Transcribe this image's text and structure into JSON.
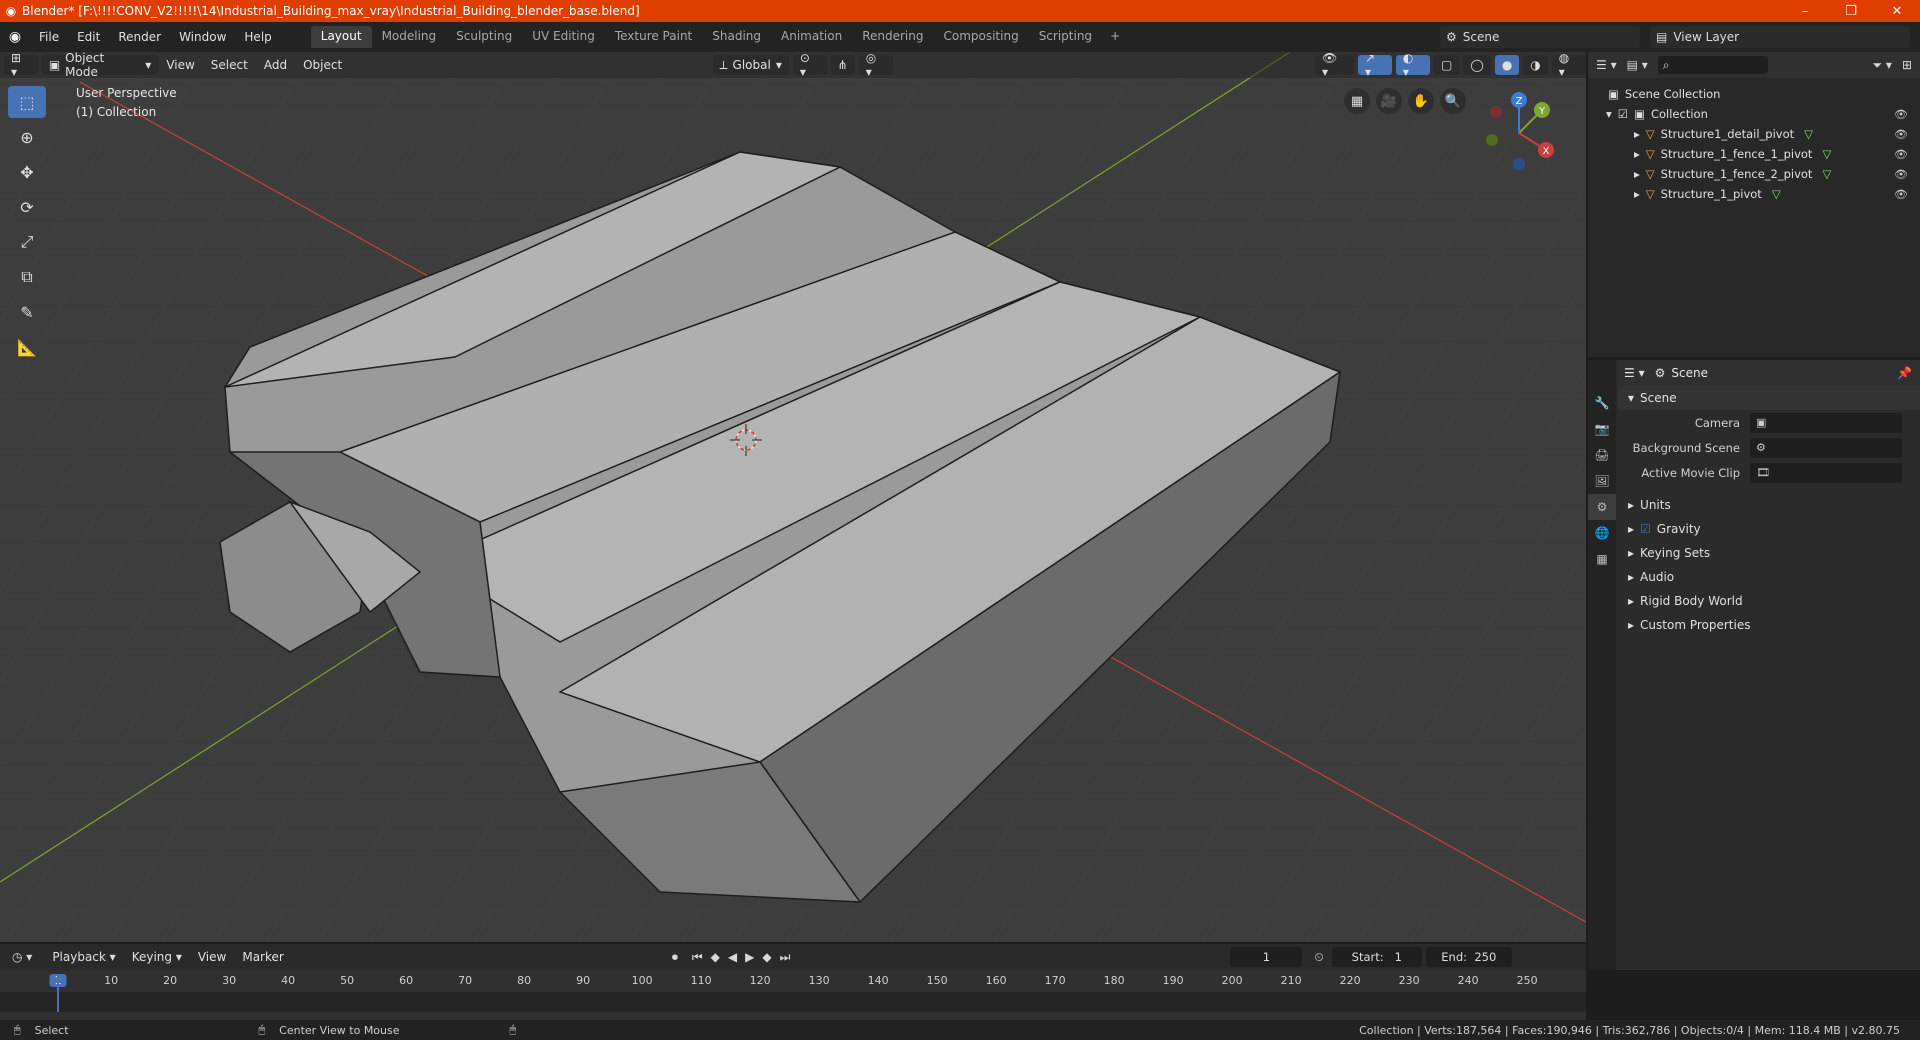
{
  "window": {
    "title": "Blender* [F:\\!!!!CONV_V2!!!!!\\14\\Industrial_Building_max_vray\\Industrial_Building_blender_base.blend]",
    "minimize": "–",
    "restore": "❐",
    "close": "✕"
  },
  "menu": [
    "File",
    "Edit",
    "Render",
    "Window",
    "Help"
  ],
  "workspaces": [
    "Layout",
    "Modeling",
    "Sculpting",
    "UV Editing",
    "Texture Paint",
    "Shading",
    "Animation",
    "Rendering",
    "Compositing",
    "Scripting"
  ],
  "scene_selector": "Scene",
  "view_layer": "View Layer",
  "viewport": {
    "mode": "Object Mode",
    "menus": [
      "View",
      "Select",
      "Add",
      "Object"
    ],
    "transform_orientation": "Global",
    "perspective_label": "User Perspective",
    "collection_label": "(1) Collection"
  },
  "outliner": {
    "scene_collection": "Scene Collection",
    "collection": "Collection",
    "objects": [
      "Structure1_detail_pivot",
      "Structure_1_fence_1_pivot",
      "Structure_1_fence_2_pivot",
      "Structure_1_pivot"
    ]
  },
  "properties": {
    "header": "Scene",
    "section": "Scene",
    "camera_label": "Camera",
    "background_label": "Background Scene",
    "movieclip_label": "Active Movie Clip",
    "panels": [
      "Units",
      "Gravity",
      "Keying Sets",
      "Audio",
      "Rigid Body World",
      "Custom Properties"
    ]
  },
  "timeline": {
    "menus": [
      "Playback",
      "Keying",
      "View",
      "Marker"
    ],
    "current_frame": "1",
    "start_label": "Start:",
    "start": "1",
    "end_label": "End:",
    "end": "250",
    "ruler": [
      "1",
      "10",
      "20",
      "30",
      "40",
      "50",
      "60",
      "70",
      "80",
      "90",
      "100",
      "110",
      "120",
      "130",
      "140",
      "150",
      "160",
      "170",
      "180",
      "190",
      "200",
      "210",
      "220",
      "230",
      "240",
      "250"
    ]
  },
  "status": {
    "left_action": "Select",
    "mid_action": "Center View to Mouse",
    "stats": "Collection | Verts:187,564 | Faces:190,946 | Tris:362,786 | Objects:0/4 | Mem: 118.4 MB | v2.80.75"
  },
  "colors": {
    "titlebar": "#e03e00",
    "accent": "#4772b3",
    "x_axis": "#c9403e",
    "y_axis": "#7fa62e",
    "z_axis": "#3d7bd6"
  }
}
